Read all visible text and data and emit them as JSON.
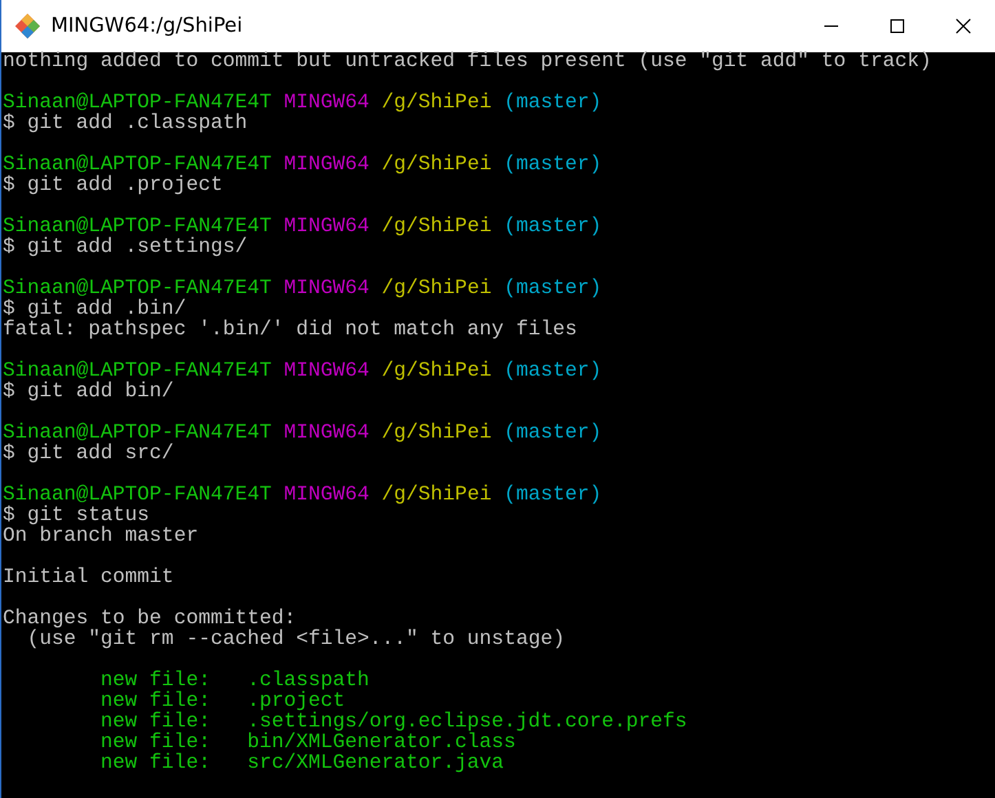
{
  "window": {
    "title": "MINGW64:/g/ShiPei"
  },
  "terminal": {
    "lines": [
      {
        "kind": "output",
        "text": "nothing added to commit but untracked files present (use \"git add\" to track)"
      },
      {
        "kind": "blank"
      },
      {
        "kind": "prompt",
        "user": "Sinaan@LAPTOP-FAN47E4T",
        "shell": "MINGW64",
        "path": "/g/ShiPei",
        "branch": "(master)"
      },
      {
        "kind": "command",
        "text": "$ git add .classpath"
      },
      {
        "kind": "blank"
      },
      {
        "kind": "prompt",
        "user": "Sinaan@LAPTOP-FAN47E4T",
        "shell": "MINGW64",
        "path": "/g/ShiPei",
        "branch": "(master)"
      },
      {
        "kind": "command",
        "text": "$ git add .project"
      },
      {
        "kind": "blank"
      },
      {
        "kind": "prompt",
        "user": "Sinaan@LAPTOP-FAN47E4T",
        "shell": "MINGW64",
        "path": "/g/ShiPei",
        "branch": "(master)"
      },
      {
        "kind": "command",
        "text": "$ git add .settings/"
      },
      {
        "kind": "blank"
      },
      {
        "kind": "prompt",
        "user": "Sinaan@LAPTOP-FAN47E4T",
        "shell": "MINGW64",
        "path": "/g/ShiPei",
        "branch": "(master)"
      },
      {
        "kind": "command",
        "text": "$ git add .bin/"
      },
      {
        "kind": "output",
        "text": "fatal: pathspec '.bin/' did not match any files"
      },
      {
        "kind": "blank"
      },
      {
        "kind": "prompt",
        "user": "Sinaan@LAPTOP-FAN47E4T",
        "shell": "MINGW64",
        "path": "/g/ShiPei",
        "branch": "(master)"
      },
      {
        "kind": "command",
        "text": "$ git add bin/"
      },
      {
        "kind": "blank"
      },
      {
        "kind": "prompt",
        "user": "Sinaan@LAPTOP-FAN47E4T",
        "shell": "MINGW64",
        "path": "/g/ShiPei",
        "branch": "(master)"
      },
      {
        "kind": "command",
        "text": "$ git add src/"
      },
      {
        "kind": "blank"
      },
      {
        "kind": "prompt",
        "user": "Sinaan@LAPTOP-FAN47E4T",
        "shell": "MINGW64",
        "path": "/g/ShiPei",
        "branch": "(master)"
      },
      {
        "kind": "command",
        "text": "$ git status"
      },
      {
        "kind": "output",
        "text": "On branch master"
      },
      {
        "kind": "blank"
      },
      {
        "kind": "output",
        "text": "Initial commit"
      },
      {
        "kind": "blank"
      },
      {
        "kind": "output",
        "text": "Changes to be committed:"
      },
      {
        "kind": "output",
        "text": "  (use \"git rm --cached <file>...\" to unstage)"
      },
      {
        "kind": "blank"
      },
      {
        "kind": "staged",
        "label": "new file:",
        "file": ".classpath"
      },
      {
        "kind": "staged",
        "label": "new file:",
        "file": ".project"
      },
      {
        "kind": "staged",
        "label": "new file:",
        "file": ".settings/org.eclipse.jdt.core.prefs"
      },
      {
        "kind": "staged",
        "label": "new file:",
        "file": "bin/XMLGenerator.class"
      },
      {
        "kind": "staged",
        "label": "new file:",
        "file": "src/XMLGenerator.java"
      }
    ]
  }
}
